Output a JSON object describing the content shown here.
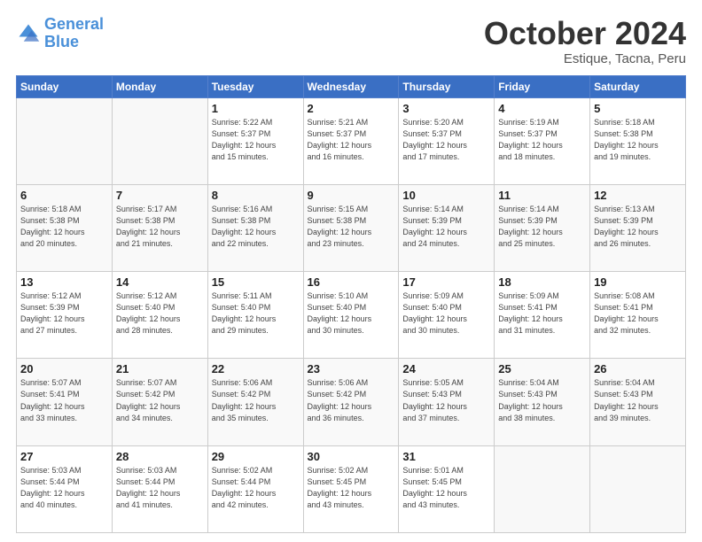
{
  "header": {
    "logo_line1": "General",
    "logo_line2": "Blue",
    "month": "October 2024",
    "location": "Estique, Tacna, Peru"
  },
  "weekdays": [
    "Sunday",
    "Monday",
    "Tuesday",
    "Wednesday",
    "Thursday",
    "Friday",
    "Saturday"
  ],
  "weeks": [
    [
      {
        "day": "",
        "info": ""
      },
      {
        "day": "",
        "info": ""
      },
      {
        "day": "1",
        "info": "Sunrise: 5:22 AM\nSunset: 5:37 PM\nDaylight: 12 hours\nand 15 minutes."
      },
      {
        "day": "2",
        "info": "Sunrise: 5:21 AM\nSunset: 5:37 PM\nDaylight: 12 hours\nand 16 minutes."
      },
      {
        "day": "3",
        "info": "Sunrise: 5:20 AM\nSunset: 5:37 PM\nDaylight: 12 hours\nand 17 minutes."
      },
      {
        "day": "4",
        "info": "Sunrise: 5:19 AM\nSunset: 5:37 PM\nDaylight: 12 hours\nand 18 minutes."
      },
      {
        "day": "5",
        "info": "Sunrise: 5:18 AM\nSunset: 5:38 PM\nDaylight: 12 hours\nand 19 minutes."
      }
    ],
    [
      {
        "day": "6",
        "info": "Sunrise: 5:18 AM\nSunset: 5:38 PM\nDaylight: 12 hours\nand 20 minutes."
      },
      {
        "day": "7",
        "info": "Sunrise: 5:17 AM\nSunset: 5:38 PM\nDaylight: 12 hours\nand 21 minutes."
      },
      {
        "day": "8",
        "info": "Sunrise: 5:16 AM\nSunset: 5:38 PM\nDaylight: 12 hours\nand 22 minutes."
      },
      {
        "day": "9",
        "info": "Sunrise: 5:15 AM\nSunset: 5:38 PM\nDaylight: 12 hours\nand 23 minutes."
      },
      {
        "day": "10",
        "info": "Sunrise: 5:14 AM\nSunset: 5:39 PM\nDaylight: 12 hours\nand 24 minutes."
      },
      {
        "day": "11",
        "info": "Sunrise: 5:14 AM\nSunset: 5:39 PM\nDaylight: 12 hours\nand 25 minutes."
      },
      {
        "day": "12",
        "info": "Sunrise: 5:13 AM\nSunset: 5:39 PM\nDaylight: 12 hours\nand 26 minutes."
      }
    ],
    [
      {
        "day": "13",
        "info": "Sunrise: 5:12 AM\nSunset: 5:39 PM\nDaylight: 12 hours\nand 27 minutes."
      },
      {
        "day": "14",
        "info": "Sunrise: 5:12 AM\nSunset: 5:40 PM\nDaylight: 12 hours\nand 28 minutes."
      },
      {
        "day": "15",
        "info": "Sunrise: 5:11 AM\nSunset: 5:40 PM\nDaylight: 12 hours\nand 29 minutes."
      },
      {
        "day": "16",
        "info": "Sunrise: 5:10 AM\nSunset: 5:40 PM\nDaylight: 12 hours\nand 30 minutes."
      },
      {
        "day": "17",
        "info": "Sunrise: 5:09 AM\nSunset: 5:40 PM\nDaylight: 12 hours\nand 30 minutes."
      },
      {
        "day": "18",
        "info": "Sunrise: 5:09 AM\nSunset: 5:41 PM\nDaylight: 12 hours\nand 31 minutes."
      },
      {
        "day": "19",
        "info": "Sunrise: 5:08 AM\nSunset: 5:41 PM\nDaylight: 12 hours\nand 32 minutes."
      }
    ],
    [
      {
        "day": "20",
        "info": "Sunrise: 5:07 AM\nSunset: 5:41 PM\nDaylight: 12 hours\nand 33 minutes."
      },
      {
        "day": "21",
        "info": "Sunrise: 5:07 AM\nSunset: 5:42 PM\nDaylight: 12 hours\nand 34 minutes."
      },
      {
        "day": "22",
        "info": "Sunrise: 5:06 AM\nSunset: 5:42 PM\nDaylight: 12 hours\nand 35 minutes."
      },
      {
        "day": "23",
        "info": "Sunrise: 5:06 AM\nSunset: 5:42 PM\nDaylight: 12 hours\nand 36 minutes."
      },
      {
        "day": "24",
        "info": "Sunrise: 5:05 AM\nSunset: 5:43 PM\nDaylight: 12 hours\nand 37 minutes."
      },
      {
        "day": "25",
        "info": "Sunrise: 5:04 AM\nSunset: 5:43 PM\nDaylight: 12 hours\nand 38 minutes."
      },
      {
        "day": "26",
        "info": "Sunrise: 5:04 AM\nSunset: 5:43 PM\nDaylight: 12 hours\nand 39 minutes."
      }
    ],
    [
      {
        "day": "27",
        "info": "Sunrise: 5:03 AM\nSunset: 5:44 PM\nDaylight: 12 hours\nand 40 minutes."
      },
      {
        "day": "28",
        "info": "Sunrise: 5:03 AM\nSunset: 5:44 PM\nDaylight: 12 hours\nand 41 minutes."
      },
      {
        "day": "29",
        "info": "Sunrise: 5:02 AM\nSunset: 5:44 PM\nDaylight: 12 hours\nand 42 minutes."
      },
      {
        "day": "30",
        "info": "Sunrise: 5:02 AM\nSunset: 5:45 PM\nDaylight: 12 hours\nand 43 minutes."
      },
      {
        "day": "31",
        "info": "Sunrise: 5:01 AM\nSunset: 5:45 PM\nDaylight: 12 hours\nand 43 minutes."
      },
      {
        "day": "",
        "info": ""
      },
      {
        "day": "",
        "info": ""
      }
    ]
  ]
}
